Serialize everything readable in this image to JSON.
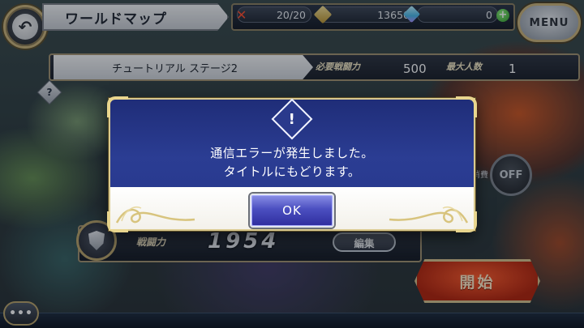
{
  "header": {
    "title": "ワールドマップ",
    "menu_label": "MENU"
  },
  "resources": {
    "stamina": "20/20",
    "gold": "13650",
    "gems": "0"
  },
  "stage": {
    "name": "チュートリアル ステージ2",
    "required_power_label": "必要戦闘力",
    "required_power_value": "500",
    "max_members_label": "最大人数",
    "max_members_value": "1"
  },
  "party": {
    "power_label": "戦闘力",
    "power_value": "1954",
    "edit_label": "編集"
  },
  "controls": {
    "consume_label": "消費",
    "toggle_label": "OFF",
    "start_label": "開始",
    "more_label": "•••",
    "help_label": "?"
  },
  "dialog": {
    "line1": "通信エラーが発生しました。",
    "line2": "タイトルにもどります。",
    "ok_label": "OK",
    "border_color": "#d9c98f",
    "body_color": "#2b3d93"
  },
  "icons": {
    "back": "back-arrow-icon",
    "stamina": "stamina-x-icon",
    "gold": "coin-icon",
    "gem": "gem-icon",
    "add": "plus-icon",
    "warning": "warning-icon",
    "shield": "shield-icon"
  }
}
